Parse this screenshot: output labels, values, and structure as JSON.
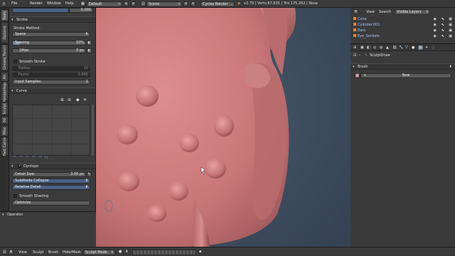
{
  "topbar": {
    "menu": [
      "File",
      "Render",
      "Window",
      "Help"
    ],
    "screen_layout": "Default",
    "scene": "Scene",
    "render_engine": "Cycles Render",
    "stats": "v2.79 | Verts:87,635 | Tris:175,262 | Nose"
  },
  "tabs": [
    "Tools",
    "Options",
    "Grease Pencil",
    "Alt",
    "Retopology",
    "Sculpt",
    "SV",
    "Misc",
    "Fast Carve"
  ],
  "tool": {
    "top_value": "0.000",
    "stroke": {
      "header": "Stroke",
      "method_label": "Stroke Method:",
      "method_value": "Space",
      "spacing_label": "Spacing",
      "spacing_value": "10%",
      "spacing_fraction": 0.1,
      "jitter_label": "Jitter:",
      "jitter_value": "0 px",
      "smooth_stroke": "Smooth Stroke",
      "radius_label": "Radius",
      "radius_value": "10",
      "factor_label": "Factor",
      "factor_value": "0.900",
      "input_samples_label": "Input Samples:",
      "input_samples_value": "1"
    },
    "curve": {
      "header": "Curve"
    },
    "dyntopo": {
      "header": "Dyntopo",
      "detail_label": "Detail Size:",
      "detail_value": "3.00 px",
      "subdivide": "Subdivide Collapse",
      "relative": "Relative Detail",
      "smooth_shading": "Smooth Shading",
      "optimize": "Optimize"
    }
  },
  "operator": {
    "header": "Operator"
  },
  "outliner": {
    "view": "View",
    "search": "Search",
    "filter": "Visible Layers",
    "items": [
      "Cone",
      "Cylinder.001",
      "Ears",
      "Eye_Sockets"
    ]
  },
  "properties": {
    "breadcrumb": "SculptDraw",
    "brush_panel": "Brush",
    "new_button": "New"
  },
  "bottombar": {
    "view": "View",
    "sculpt": "Sculpt",
    "brush": "Brush",
    "hide_mask": "Hide/Mask",
    "mode": "Sculpt Mode"
  },
  "colors": {
    "sculpt": "#c9787a",
    "viewport_bg": "#3c4b5d",
    "panel": "#3b3b3b",
    "accent_blue": "#4a6286"
  }
}
